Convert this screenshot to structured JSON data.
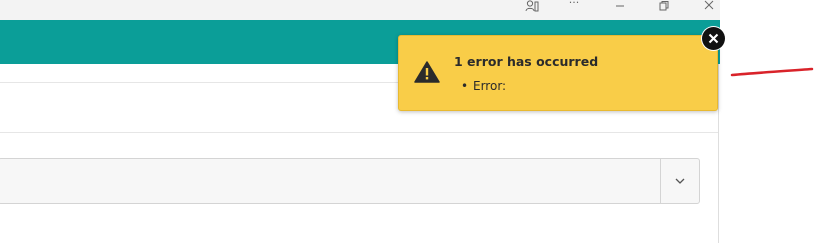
{
  "window": {
    "buttons": [
      "person-search-icon",
      "more-icon",
      "minimize-icon",
      "restore-icon",
      "close-icon"
    ],
    "more_label": "···"
  },
  "header": {
    "color": "#0b9e98"
  },
  "toast": {
    "title": "1 error has occurred",
    "errors": [
      "Error:"
    ],
    "bullet": "•",
    "bg_color": "#f9cd48",
    "icon": "warning-icon",
    "close_icon": "close-icon"
  },
  "dropdown": {
    "selected": "",
    "icon": "chevron-down-icon"
  },
  "annotation": {
    "color": "#d9232a"
  }
}
